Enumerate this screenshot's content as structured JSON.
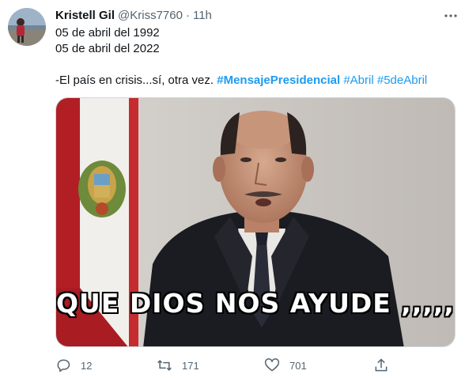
{
  "tweet": {
    "author_name": "Kristell Gil",
    "handle": "@Kriss7760",
    "separator": "·",
    "time": "11h",
    "lines": [
      "05 de abril del 1992",
      "05 de abril del 2022"
    ],
    "body_prefix": "-El país en crisis...sí, otra vez. ",
    "hashtags": [
      "#MensajePresidencial",
      "#Abril",
      "#5deAbril"
    ]
  },
  "media": {
    "caption": "QUE DIOS NOS AYUDE ,,,,,  !!"
  },
  "actions": {
    "reply_count": "12",
    "retweet_count": "171",
    "like_count": "701"
  },
  "icons": {
    "more": "more-horizontal-icon",
    "reply": "reply-icon",
    "retweet": "retweet-icon",
    "like": "heart-icon",
    "share": "share-icon"
  },
  "colors": {
    "link": "#1d9bf0",
    "secondary_text": "#536471",
    "primary_text": "#0f1419"
  }
}
